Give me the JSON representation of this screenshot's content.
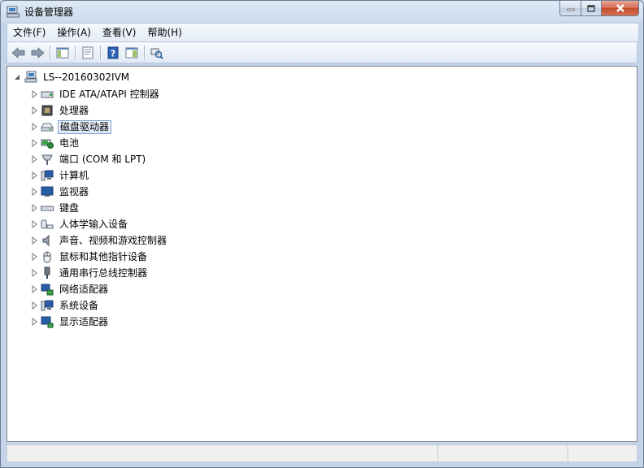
{
  "window": {
    "title": "设备管理器",
    "icon": "device-manager-icon",
    "caption_buttons": [
      "minimize-icon",
      "maximize-icon",
      "close-icon"
    ]
  },
  "menubar": {
    "items": [
      {
        "label": "文件(F)"
      },
      {
        "label": "操作(A)"
      },
      {
        "label": "查看(V)"
      },
      {
        "label": "帮助(H)"
      }
    ]
  },
  "toolbar": {
    "buttons": [
      "back-arrow-icon",
      "forward-arrow-icon",
      "show-hide-tree-icon",
      "properties-icon",
      "help-icon",
      "action-pane-icon",
      "scan-hardware-icon"
    ]
  },
  "tree": {
    "root": {
      "label": "LS--20160302IVM",
      "icon": "computer-icon",
      "expanded": true
    },
    "children": [
      {
        "label": "IDE ATA/ATAPI 控制器",
        "icon": "ide-controller-icon"
      },
      {
        "label": "处理器",
        "icon": "processor-icon"
      },
      {
        "label": "磁盘驱动器",
        "icon": "disk-drive-icon",
        "selected": true
      },
      {
        "label": "电池",
        "icon": "battery-icon"
      },
      {
        "label": "端口 (COM 和 LPT)",
        "icon": "port-icon"
      },
      {
        "label": "计算机",
        "icon": "computer-icon"
      },
      {
        "label": "监视器",
        "icon": "monitor-icon"
      },
      {
        "label": "键盘",
        "icon": "keyboard-icon"
      },
      {
        "label": "人体学输入设备",
        "icon": "hid-icon"
      },
      {
        "label": "声音、视频和游戏控制器",
        "icon": "speaker-icon"
      },
      {
        "label": "鼠标和其他指针设备",
        "icon": "mouse-icon"
      },
      {
        "label": "通用串行总线控制器",
        "icon": "usb-icon"
      },
      {
        "label": "网络适配器",
        "icon": "network-adapter-icon"
      },
      {
        "label": "系统设备",
        "icon": "system-device-icon"
      },
      {
        "label": "显示适配器",
        "icon": "display-adapter-icon"
      }
    ]
  },
  "colors": {
    "title_bar": "#cfdcee",
    "selection_border": "#7da2ce",
    "close_button": "#c24a2c"
  }
}
